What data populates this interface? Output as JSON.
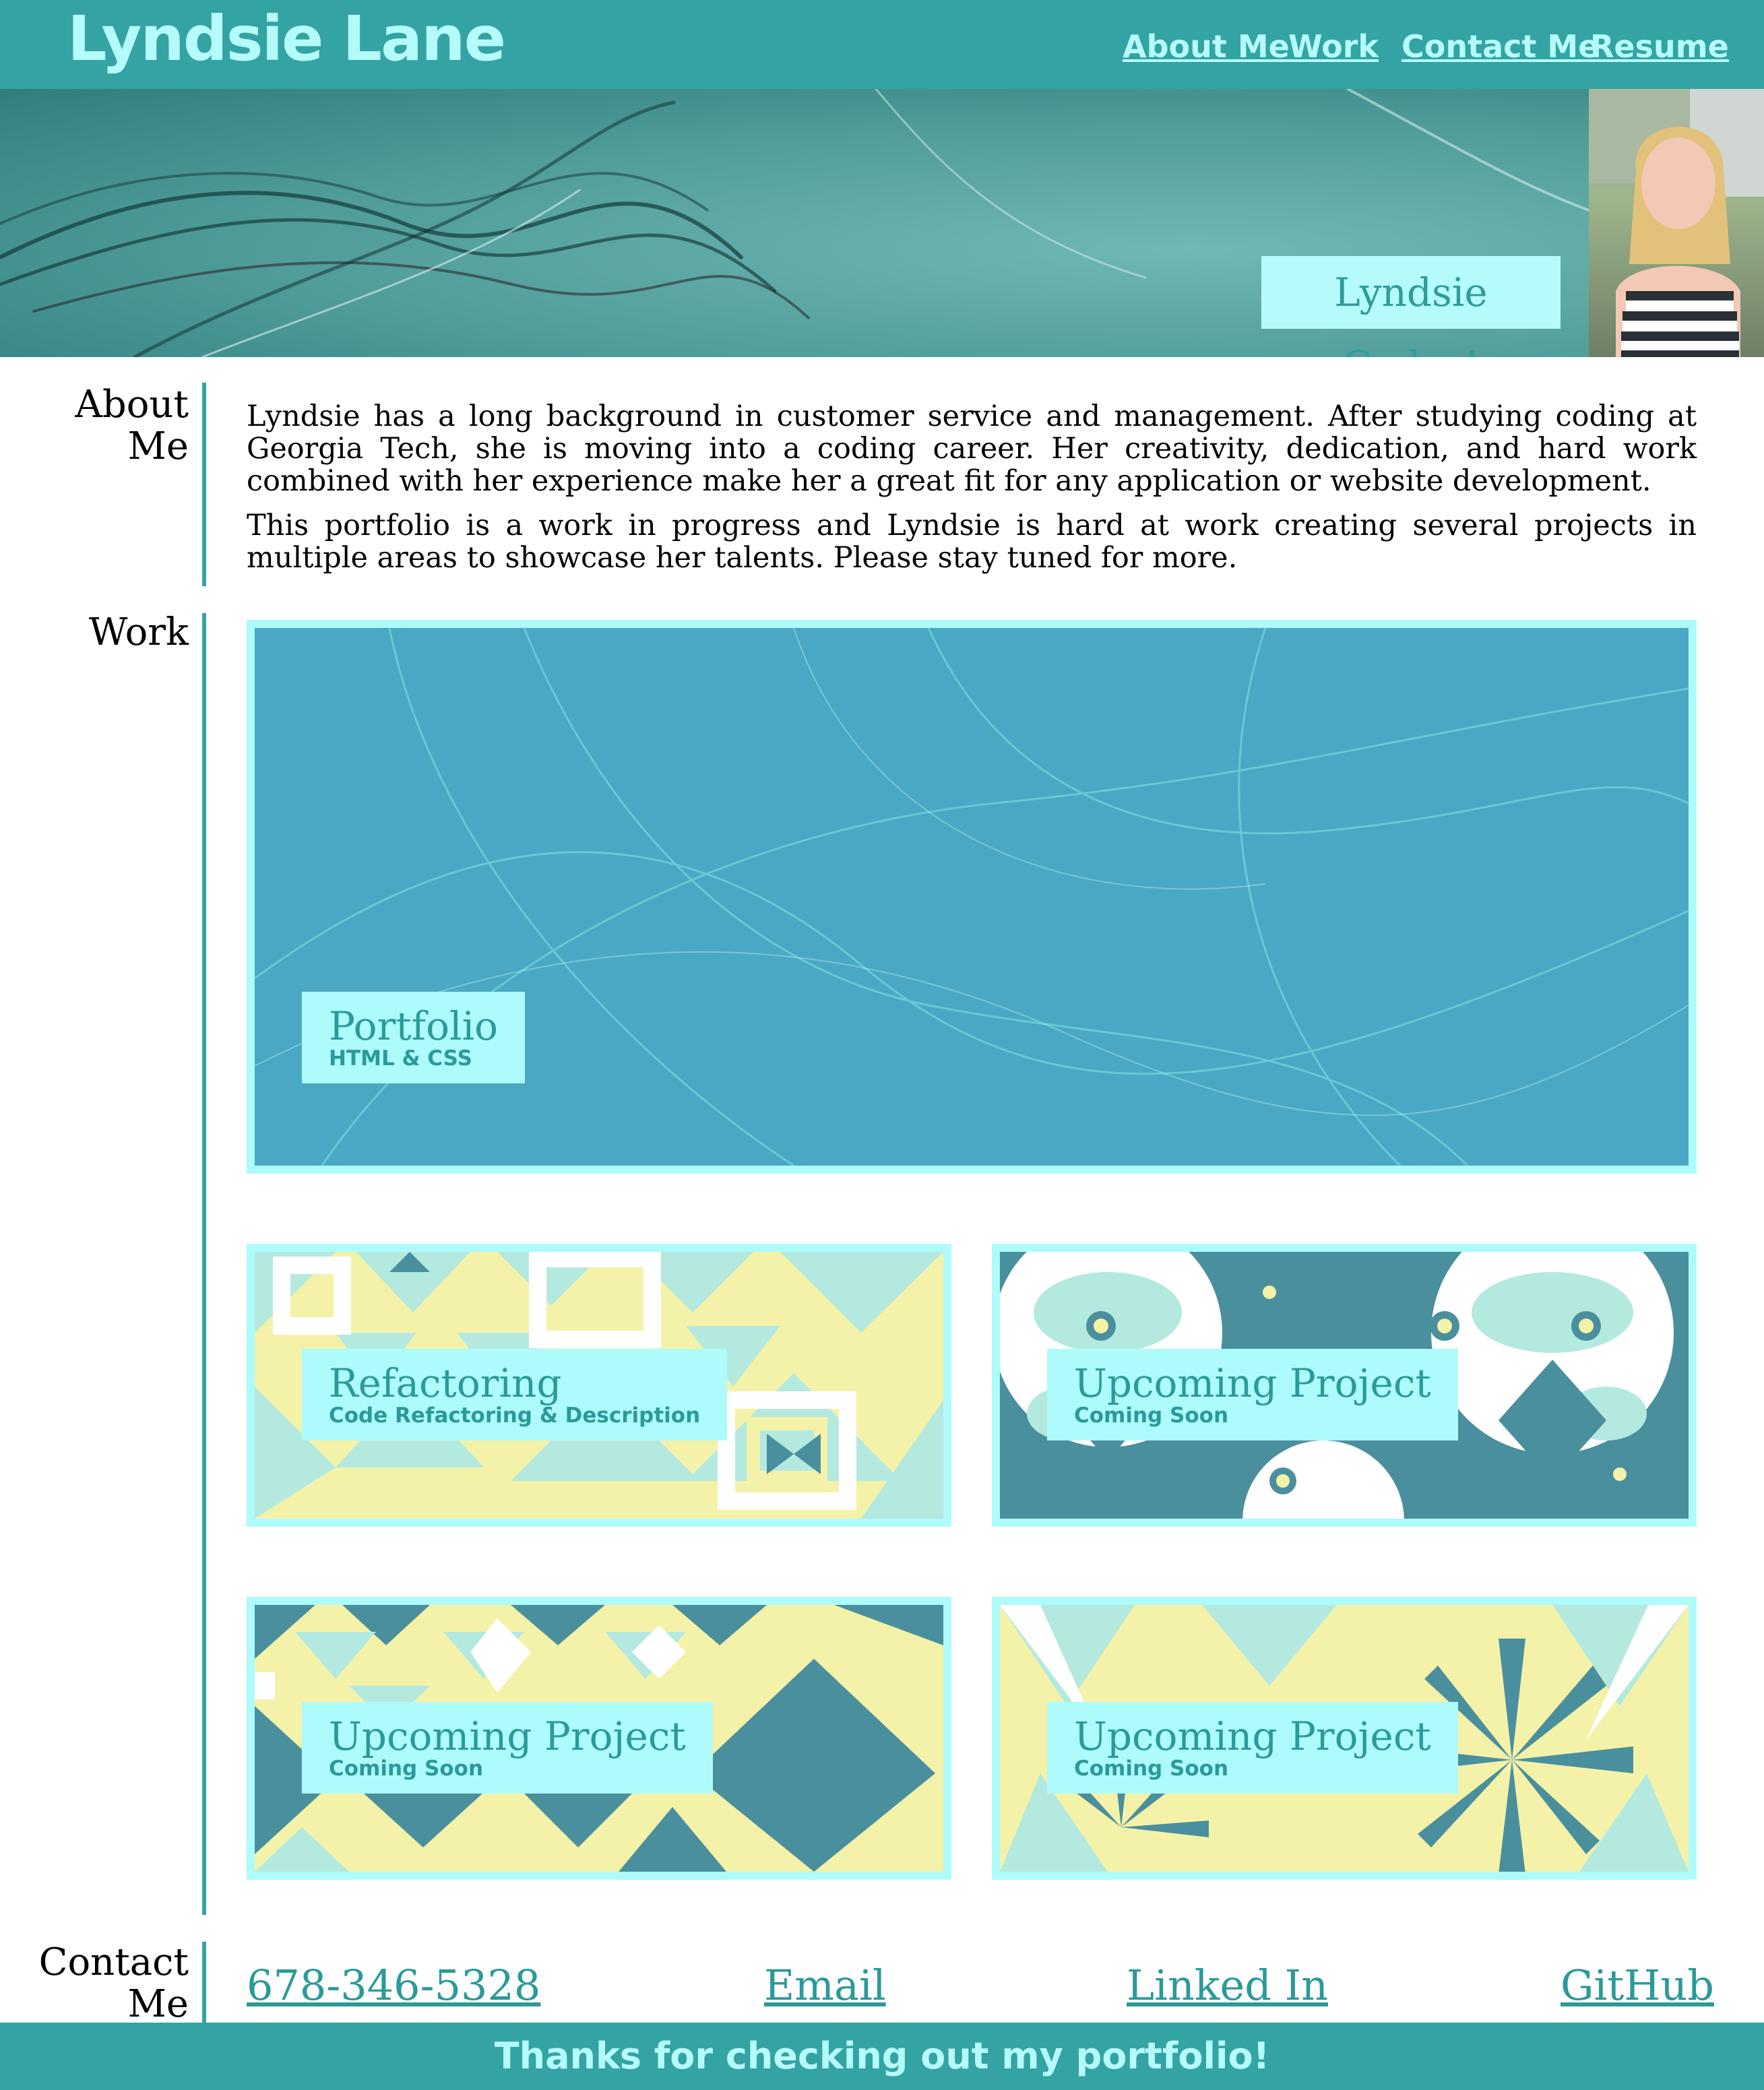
{
  "header": {
    "brand": "Lyndsie Lane",
    "nav": [
      {
        "label": "About Me"
      },
      {
        "label": "Work"
      },
      {
        "label": "Contact Me"
      },
      {
        "label": "Resume"
      }
    ]
  },
  "hero": {
    "tagline": "Lyndsie Codes!",
    "photo_icon": "profile-photo"
  },
  "about": {
    "heading": "About Me",
    "paragraphs": [
      "Lyndsie has a long background in customer service and management. After studying coding at Georgia Tech, she is moving into a coding career. Her creativity, dedication, and hard work combined with her experience make her a great fit for any application or website development.",
      "This portfolio is a work in progress and Lyndsie is hard at work creating several projects in multiple areas to showcase her talents. Please stay tuned for more."
    ]
  },
  "work": {
    "heading": "Work",
    "projects": [
      {
        "title": "Portfolio",
        "subtitle": "HTML & CSS"
      },
      {
        "title": "Refactoring",
        "subtitle": "Code Refactoring & Description"
      },
      {
        "title": "Upcoming Project",
        "subtitle": "Coming Soon"
      },
      {
        "title": "Upcoming Project",
        "subtitle": "Coming Soon"
      },
      {
        "title": "Upcoming Project",
        "subtitle": "Coming Soon"
      }
    ]
  },
  "contact": {
    "heading": "Contact Me",
    "links": [
      {
        "label": "678-346-5328"
      },
      {
        "label": "Email"
      },
      {
        "label": "Linked In"
      },
      {
        "label": "GitHub"
      }
    ]
  },
  "footer": {
    "text": "Thanks for checking out my portfolio!"
  },
  "colors": {
    "primary": "#34a3a3",
    "accent_light": "#b6fbfb",
    "tile_border": "#aefbfb",
    "text_accent": "#2a9a9a",
    "pattern_yellow": "#f4f2a8",
    "pattern_mint": "#b4e9e0",
    "pattern_teal": "#4a8f9e"
  }
}
